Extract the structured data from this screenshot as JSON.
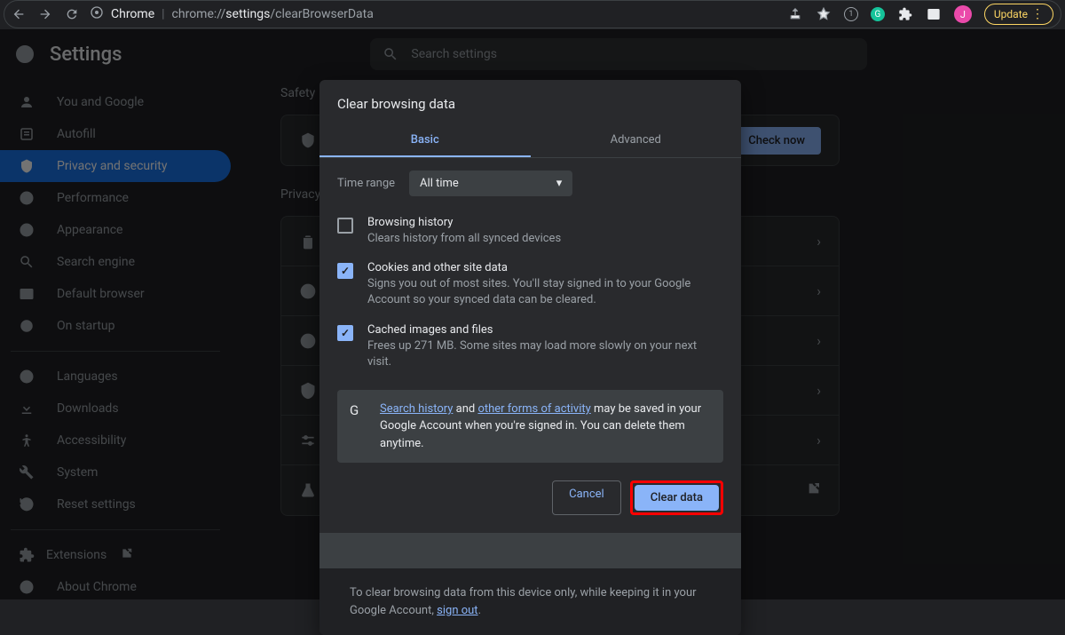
{
  "browser": {
    "app_name": "Chrome",
    "url_scheme": "chrome://",
    "url_host": "settings",
    "url_path": "/clearBrowserData",
    "profile_letter": "J",
    "update_label": "Update"
  },
  "header": {
    "title": "Settings",
    "search_placeholder": "Search settings"
  },
  "sidebar": {
    "items": [
      {
        "label": "You and Google"
      },
      {
        "label": "Autofill"
      },
      {
        "label": "Privacy and security"
      },
      {
        "label": "Performance"
      },
      {
        "label": "Appearance"
      },
      {
        "label": "Search engine"
      },
      {
        "label": "Default browser"
      },
      {
        "label": "On startup"
      }
    ],
    "items2": [
      {
        "label": "Languages"
      },
      {
        "label": "Downloads"
      },
      {
        "label": "Accessibility"
      },
      {
        "label": "System"
      },
      {
        "label": "Reset settings"
      }
    ],
    "items3": [
      {
        "label": "Extensions"
      },
      {
        "label": "About Chrome"
      }
    ]
  },
  "content": {
    "safety_label": "Safety",
    "privacy_label": "Privacy",
    "check_now": "Check now"
  },
  "dialog": {
    "title": "Clear browsing data",
    "tabs": {
      "basic": "Basic",
      "advanced": "Advanced"
    },
    "time_range_label": "Time range",
    "time_range_value": "All time",
    "items": [
      {
        "title": "Browsing history",
        "desc": "Clears history from all synced devices",
        "checked": false
      },
      {
        "title": "Cookies and other site data",
        "desc": "Signs you out of most sites. You'll stay signed in to your Google Account so your synced data can be cleared.",
        "checked": true
      },
      {
        "title": "Cached images and files",
        "desc": "Frees up 271 MB. Some sites may load more slowly on your next visit.",
        "checked": true
      }
    ],
    "info": {
      "link1": "Search history",
      "mid1": " and ",
      "link2": "other forms of activity",
      "rest": " may be saved in your Google Account when you're signed in. You can delete them anytime."
    },
    "cancel": "Cancel",
    "clear": "Clear data",
    "footer_text": "To clear browsing data from this device only, while keeping it in your Google Account, ",
    "footer_link": "sign out",
    "footer_end": "."
  }
}
